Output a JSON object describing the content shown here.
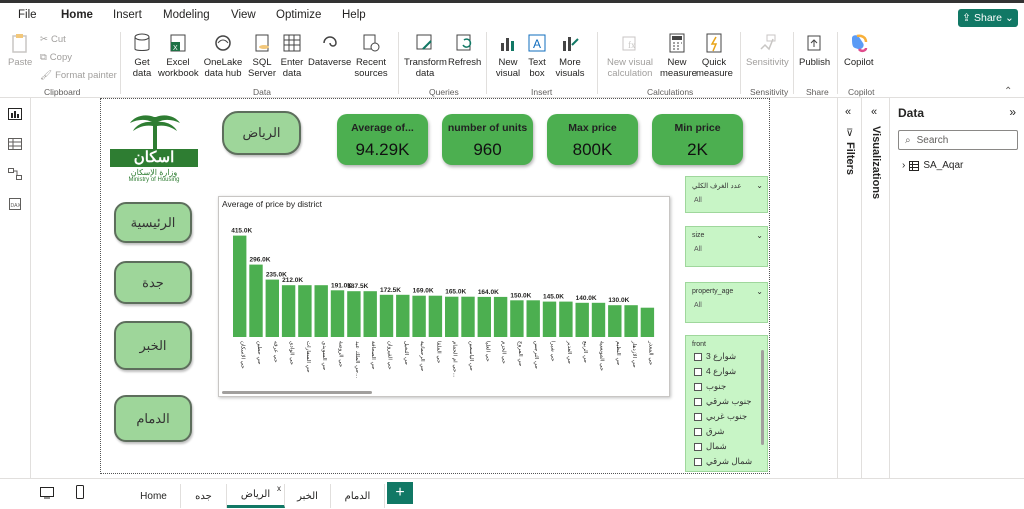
{
  "menu": {
    "items": [
      "File",
      "Home",
      "Insert",
      "Modeling",
      "View",
      "Optimize",
      "Help"
    ],
    "share_label": "Share"
  },
  "ribbon": {
    "clipboard": {
      "paste": "Paste",
      "cut": "Cut",
      "copy": "Copy",
      "format_painter": "Format painter",
      "group": "Clipboard"
    },
    "data": {
      "get_data": "Get data",
      "excel": "Excel workbook",
      "onelake": "OneLake data hub",
      "sql": "SQL Server",
      "enter": "Enter data",
      "dataverse": "Dataverse",
      "recent": "Recent sources",
      "group": "Data"
    },
    "queries": {
      "transform": "Transform data",
      "refresh": "Refresh",
      "group": "Queries"
    },
    "insert": {
      "new_visual": "New visual",
      "text_box": "Text box",
      "more_visuals": "More visuals",
      "group": "Insert"
    },
    "calculations": {
      "new_visual_calc": "New visual calculation",
      "new_measure": "New measure",
      "quick_measure": "Quick measure",
      "group": "Calculations"
    },
    "sensitivity": {
      "label": "Sensitivity",
      "group": "Sensitivity"
    },
    "share": {
      "publish": "Publish",
      "group": "Share"
    },
    "copilot": {
      "label": "Copilot",
      "group": "Copilot"
    }
  },
  "report": {
    "city_button": "الرياض",
    "nav_buttons": [
      "الرئيسية",
      "جدة",
      "الخبر",
      "الدمام"
    ],
    "cards": [
      {
        "title": "Average of...",
        "value": "94.29K"
      },
      {
        "title": "number of units",
        "value": "960"
      },
      {
        "title": "Max price",
        "value": "800K"
      },
      {
        "title": "Min price",
        "value": "2K"
      }
    ],
    "logo_text": "اسكان",
    "logo_sub": "وزارة الإسكان",
    "logo_en": "Ministry of Housing"
  },
  "chart_data": {
    "type": "bar",
    "title": "Average of price by district",
    "categories": [
      "حي الاسكان",
      "حي حطين",
      "حي عرقه",
      "حي الوادي",
      "حي السفارات",
      "حي السويدي",
      "حي الروضة",
      "حي الملك عبد...",
      "حي الصحافة",
      "حي القيروان",
      "حي النخيل",
      "حي الرحمانية",
      "حي الملقا",
      "حي ام الحمام...",
      "حي الياسمين",
      "حي العليا",
      "حي الحزم",
      "حي المروج",
      "حي النرجس",
      "حي شبرا",
      "حي الغدير",
      "حي الربيع",
      "حي المونسية",
      "حي النظيم",
      "حي الازدهار",
      "حي المعذر"
    ],
    "values": [
      415,
      296,
      235,
      212,
      212,
      212,
      191,
      187.5,
      187.5,
      172.5,
      172.5,
      169,
      169,
      165,
      165,
      164,
      164,
      150,
      150,
      145,
      145,
      140,
      140,
      130,
      130,
      120
    ],
    "data_labels": [
      "415.0K",
      "296.0K",
      "235.0K",
      "212.0K",
      "",
      "",
      "191.0K",
      "187.5K",
      "",
      "172.5K",
      "",
      "169.0K",
      "",
      "165.0K",
      "",
      "164.0K",
      "",
      "150.0K",
      "",
      "145.0K",
      "",
      "140.0K",
      "",
      "130.0K",
      "",
      ""
    ],
    "ylim": [
      0,
      450
    ],
    "unit": "K",
    "color": "#4caf50"
  },
  "slicers": [
    {
      "title": "عدد الغرف الكلي",
      "value": "All"
    },
    {
      "title": "size",
      "value": "All"
    },
    {
      "title": "property_age",
      "value": "All"
    }
  ],
  "front_slicer": {
    "title": "front",
    "options": [
      "شوارع 3",
      "شوارع 4",
      "جنوب",
      "جنوب شرقي",
      "جنوب غربي",
      "شرق",
      "شمال",
      "شمال شرقي"
    ]
  },
  "panes": {
    "filters": "Filters",
    "visualizations": "Visualizations",
    "data": "Data",
    "search_placeholder": "Search",
    "table": "SA_Aqar"
  },
  "tabs": [
    "Home",
    "جده",
    "الرياض",
    "الخبر",
    "الدمام"
  ],
  "active_tab": "الرياض",
  "colors": {
    "accent": "#117865",
    "card": "#4caf50",
    "button": "#9ed69a",
    "slicer": "#c8f5c6",
    "bar": "#4caf50"
  }
}
